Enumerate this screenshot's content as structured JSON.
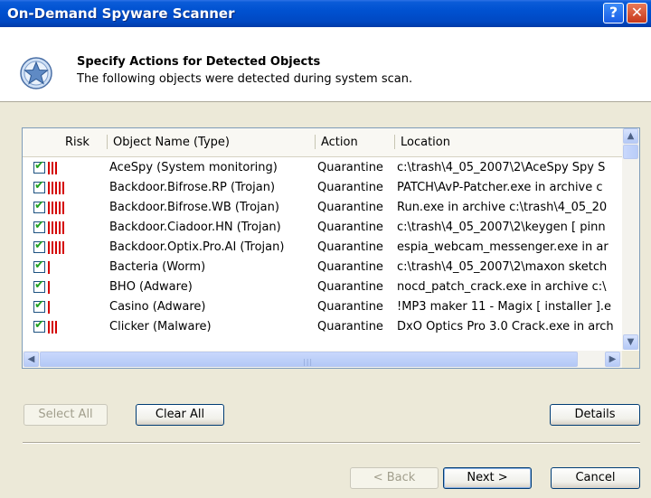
{
  "window": {
    "title": "On-Demand Spyware Scanner"
  },
  "titlebar_buttons": {
    "help": "?",
    "close": "✕"
  },
  "header": {
    "title": "Specify Actions for Detected Objects",
    "subtitle": "The following objects were detected during system scan.",
    "icon": "star-shield-icon"
  },
  "list": {
    "columns": {
      "risk": "Risk",
      "name": "Object Name (Type)",
      "action": "Action",
      "location": "Location"
    },
    "rows": [
      {
        "checked": true,
        "risk": 3,
        "name": "AceSpy (System monitoring)",
        "action": "Quarantine",
        "location": "c:\\trash\\4_05_2007\\2\\AceSpy Spy S"
      },
      {
        "checked": true,
        "risk": 5,
        "name": "Backdoor.Bifrose.RP (Trojan)",
        "action": "Quarantine",
        "location": "PATCH\\AvP-Patcher.exe in archive c"
      },
      {
        "checked": true,
        "risk": 5,
        "name": "Backdoor.Bifrose.WB (Trojan)",
        "action": "Quarantine",
        "location": "Run.exe in archive c:\\trash\\4_05_20"
      },
      {
        "checked": true,
        "risk": 5,
        "name": "Backdoor.Ciadoor.HN (Trojan)",
        "action": "Quarantine",
        "location": "c:\\trash\\4_05_2007\\2\\keygen [ pinn"
      },
      {
        "checked": true,
        "risk": 5,
        "name": "Backdoor.Optix.Pro.AI (Trojan)",
        "action": "Quarantine",
        "location": "espia_webcam_messenger.exe in ar"
      },
      {
        "checked": true,
        "risk": 1,
        "name": "Bacteria (Worm)",
        "action": "Quarantine",
        "location": "c:\\trash\\4_05_2007\\2\\maxon sketch"
      },
      {
        "checked": true,
        "risk": 1,
        "name": "BHO (Adware)",
        "action": "Quarantine",
        "location": "nocd_patch_crack.exe in archive c:\\"
      },
      {
        "checked": true,
        "risk": 1,
        "name": "Casino (Adware)",
        "action": "Quarantine",
        "location": "!MP3 maker 11 - Magix [ installer ].e"
      },
      {
        "checked": true,
        "risk": 3,
        "name": "Clicker (Malware)",
        "action": "Quarantine",
        "location": "DxO Optics Pro 3.0 Crack.exe in arch"
      }
    ]
  },
  "buttons": {
    "select_all": "Select All",
    "clear_all": "Clear All",
    "details": "Details",
    "back": "< Back",
    "next": "Next >",
    "cancel": "Cancel"
  },
  "colors": {
    "risk_bar": "#d40000",
    "titlebar": "#0051d0",
    "check": "#21a121"
  }
}
